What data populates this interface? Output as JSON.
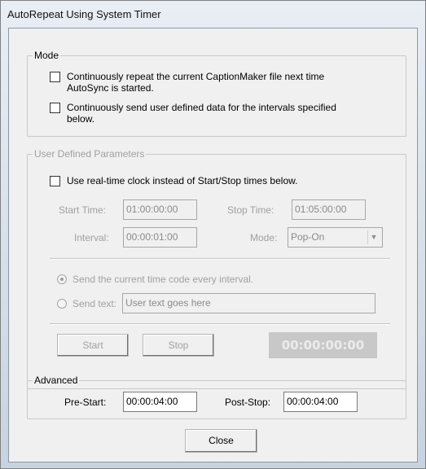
{
  "window": {
    "title": "AutoRepeat Using System Timer"
  },
  "mode": {
    "legend": "Mode",
    "repeat_line1": "Continuously repeat the current CaptionMaker file next time",
    "repeat_line2": "AutoSync is started.",
    "send_line1": "Continuously send user defined data for the intervals specified",
    "send_line2": "below."
  },
  "params": {
    "legend": "User Defined Parameters",
    "realtime_label": "Use real-time clock instead of Start/Stop times below.",
    "start_time_label": "Start Time:",
    "start_time_value": "01:00:00:00",
    "stop_time_label": "Stop Time:",
    "stop_time_value": "01:05:00:00",
    "interval_label": "Interval:",
    "interval_value": "00:00:01:00",
    "mode_label": "Mode:",
    "mode_value": "Pop-On",
    "radio_timecode_label": "Send the current time code every interval.",
    "radio_text_label": "Send text:",
    "send_text_value": "User text goes here",
    "start_button": "Start",
    "stop_button": "Stop",
    "timecode_display": "00:00:00:00"
  },
  "advanced": {
    "legend": "Advanced",
    "prestart_label": "Pre-Start:",
    "prestart_value": "00:00:04:00",
    "poststop_label": "Post-Stop:",
    "poststop_value": "00:00:04:00"
  },
  "footer": {
    "close_button": "Close"
  }
}
